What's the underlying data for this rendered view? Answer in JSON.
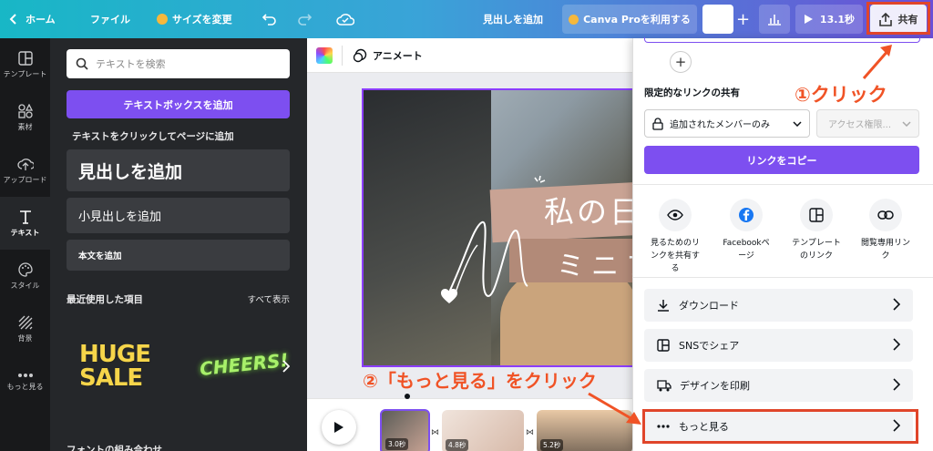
{
  "topbar": {
    "home": "ホーム",
    "file": "ファイル",
    "resize": "サイズを変更",
    "add_heading": "見出しを追加",
    "canva_pro": "Canva Proを利用する",
    "play_time": "13.1秒",
    "share": "共有"
  },
  "rail": [
    {
      "label": "テンプレート",
      "icon": "template-icon"
    },
    {
      "label": "素材",
      "icon": "elements-icon"
    },
    {
      "label": "アップロード",
      "icon": "upload-icon"
    },
    {
      "label": "テキスト",
      "icon": "text-icon"
    },
    {
      "label": "スタイル",
      "icon": "palette-icon"
    },
    {
      "label": "背景",
      "icon": "background-icon"
    },
    {
      "label": "もっと見る",
      "icon": "more-icon"
    }
  ],
  "panel": {
    "search_placeholder": "テキストを検索",
    "add_textbox": "テキストボックスを追加",
    "click_hint": "テキストをクリックしてページに追加",
    "heading": "見出しを追加",
    "subheading": "小見出しを追加",
    "body": "本文を追加",
    "recent": "最近使用した項目",
    "show_all": "すべて表示",
    "sample1_line1": "HUGE",
    "sample1_line2": "SALE",
    "sample2": "CHEERS!",
    "font_combos": "フォントの組み合わせ"
  },
  "canvas": {
    "animate": "アニメート",
    "design_text1": "私の日",
    "design_text2": "ミニブ"
  },
  "timeline": {
    "pages": [
      {
        "duration": "3.0秒"
      },
      {
        "duration": "4.8秒"
      },
      {
        "duration": "5.2秒"
      }
    ]
  },
  "share_panel": {
    "restricted_link": "限定的なリンクの共有",
    "members_only": "追加されたメンバーのみ",
    "access_placeholder": "アクセス権限...",
    "copy_link": "リンクをコピー",
    "options": [
      {
        "label": "見るためのリンクを共有する",
        "icon": "eye-icon"
      },
      {
        "label": "Facebookページ",
        "icon": "facebook-icon"
      },
      {
        "label": "テンプレートのリンク",
        "icon": "template-link-icon"
      },
      {
        "label": "閲覧専用リンク",
        "icon": "link-icon"
      }
    ],
    "rows": [
      {
        "label": "ダウンロード",
        "icon": "download-icon"
      },
      {
        "label": "SNSでシェア",
        "icon": "social-share-icon"
      },
      {
        "label": "デザインを印刷",
        "icon": "print-truck-icon"
      },
      {
        "label": "もっと見る",
        "icon": "more-dots-icon"
      }
    ]
  },
  "annotations": {
    "step1": "①クリック",
    "step2": "②「もっと見る」をクリック"
  },
  "colors": {
    "accent": "#7d4ff0",
    "annotation": "#f05326",
    "highlight_box": "#e0452a"
  }
}
